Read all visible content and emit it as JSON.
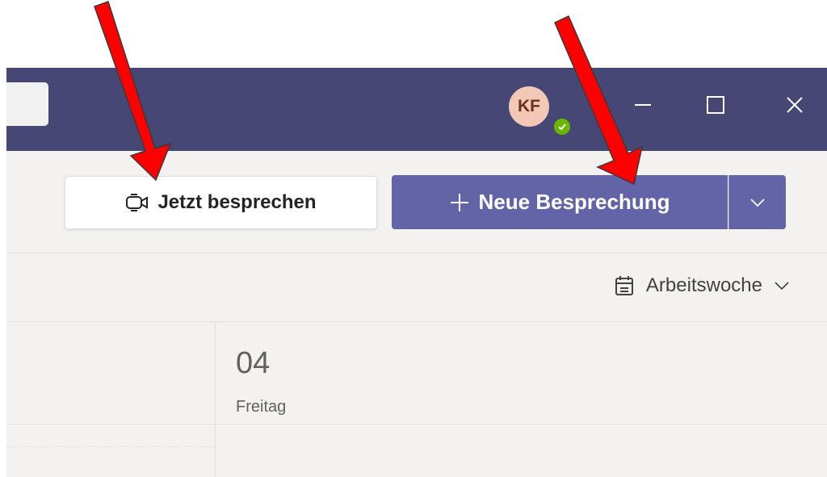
{
  "user": {
    "initials": "KF",
    "status": "available"
  },
  "toolbar": {
    "meet_now_label": "Jetzt besprechen",
    "new_meeting_label": "Neue Besprechung"
  },
  "view": {
    "label": "Arbeitswoche"
  },
  "calendar": {
    "day_number": "04",
    "day_name": "Freitag"
  },
  "colors": {
    "titlebar": "#464775",
    "accent": "#6264a7",
    "status_available": "#6bb700",
    "annotation_arrow": "#ff0000"
  }
}
